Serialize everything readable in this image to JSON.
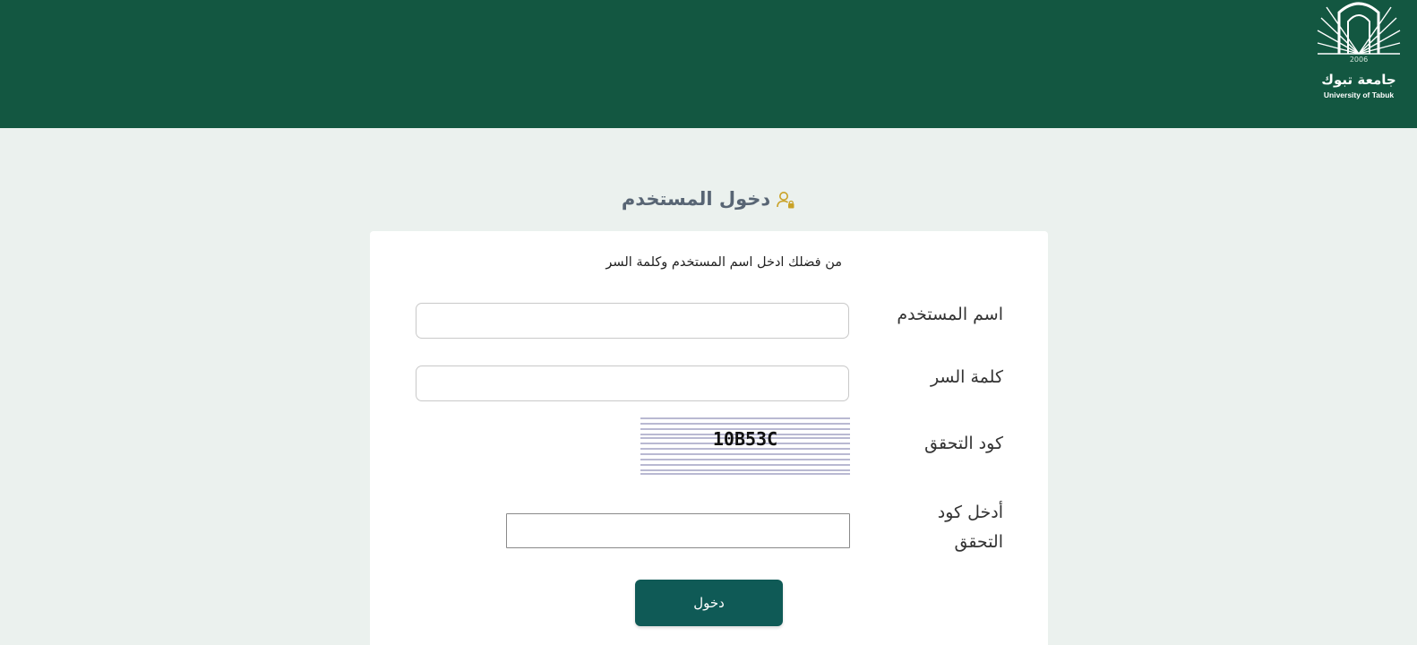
{
  "header": {
    "logo": {
      "year": "2006",
      "name_ar": "جامعة تبوك",
      "name_en": "University of Tabuk"
    }
  },
  "page": {
    "title": "دخول المستخدم",
    "title_icon": "user-lock-icon"
  },
  "form": {
    "instruction": "من فضلك ادخل اسم المستخدم وكلمة السر",
    "username_label": "اسم المستخدم",
    "username_value": "",
    "password_label": "كلمة السر",
    "password_value": "",
    "captcha_label": "كود التحقق",
    "captcha_code": "10B53C",
    "captcha_input_label": "أدخل كود التحقق",
    "captcha_input_value": "",
    "submit_label": "دخول"
  },
  "colors": {
    "header_bg": "#135741",
    "page_bg": "#ebf1ee",
    "button_bg": "#0f5a56",
    "title_icon": "#c9a227"
  }
}
